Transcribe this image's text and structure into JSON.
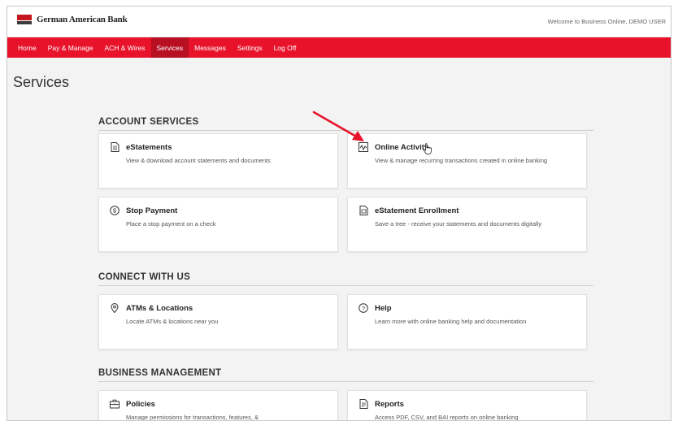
{
  "header": {
    "bank_name": "German American Bank",
    "welcome": "Welcome to Business Online, DEMO USER"
  },
  "nav": {
    "items": [
      {
        "label": "Home"
      },
      {
        "label": "Pay & Manage"
      },
      {
        "label": "ACH & Wires"
      },
      {
        "label": "Services",
        "active": true
      },
      {
        "label": "Messages"
      },
      {
        "label": "Settings"
      },
      {
        "label": "Log Off"
      }
    ]
  },
  "page": {
    "title": "Services"
  },
  "sections": [
    {
      "title": "ACCOUNT SERVICES",
      "cards": [
        {
          "title": "eStatements",
          "desc": "View & download account statements and documents",
          "icon": "document-icon"
        },
        {
          "title": "Online Activity",
          "desc": "View & manage recurring transactions created in online banking",
          "icon": "activity-chart-icon"
        },
        {
          "title": "Stop Payment",
          "desc": "Place a stop payment on a check",
          "icon": "dollar-circle-icon"
        },
        {
          "title": "eStatement Enrollment",
          "desc": "Save a tree - receive your statements and documents digitally",
          "icon": "document-enroll-icon"
        }
      ]
    },
    {
      "title": "CONNECT WITH US",
      "cards": [
        {
          "title": "ATMs & Locations",
          "desc": "Locate ATMs & locations near you",
          "icon": "location-pin-icon"
        },
        {
          "title": "Help",
          "desc": "Learn more with online banking help and documentation",
          "icon": "help-circle-icon"
        }
      ]
    },
    {
      "title": "BUSINESS MANAGEMENT",
      "cards": [
        {
          "title": "Policies",
          "desc": "Manage permissions for transactions, features, &",
          "icon": "policies-icon"
        },
        {
          "title": "Reports",
          "desc": "Access PDF, CSV, and BAI reports on online banking",
          "icon": "report-icon"
        }
      ]
    }
  ],
  "colors": {
    "nav_bg": "#e8132b",
    "nav_active": "#b80f22",
    "annotation_arrow": "#e8132b"
  }
}
